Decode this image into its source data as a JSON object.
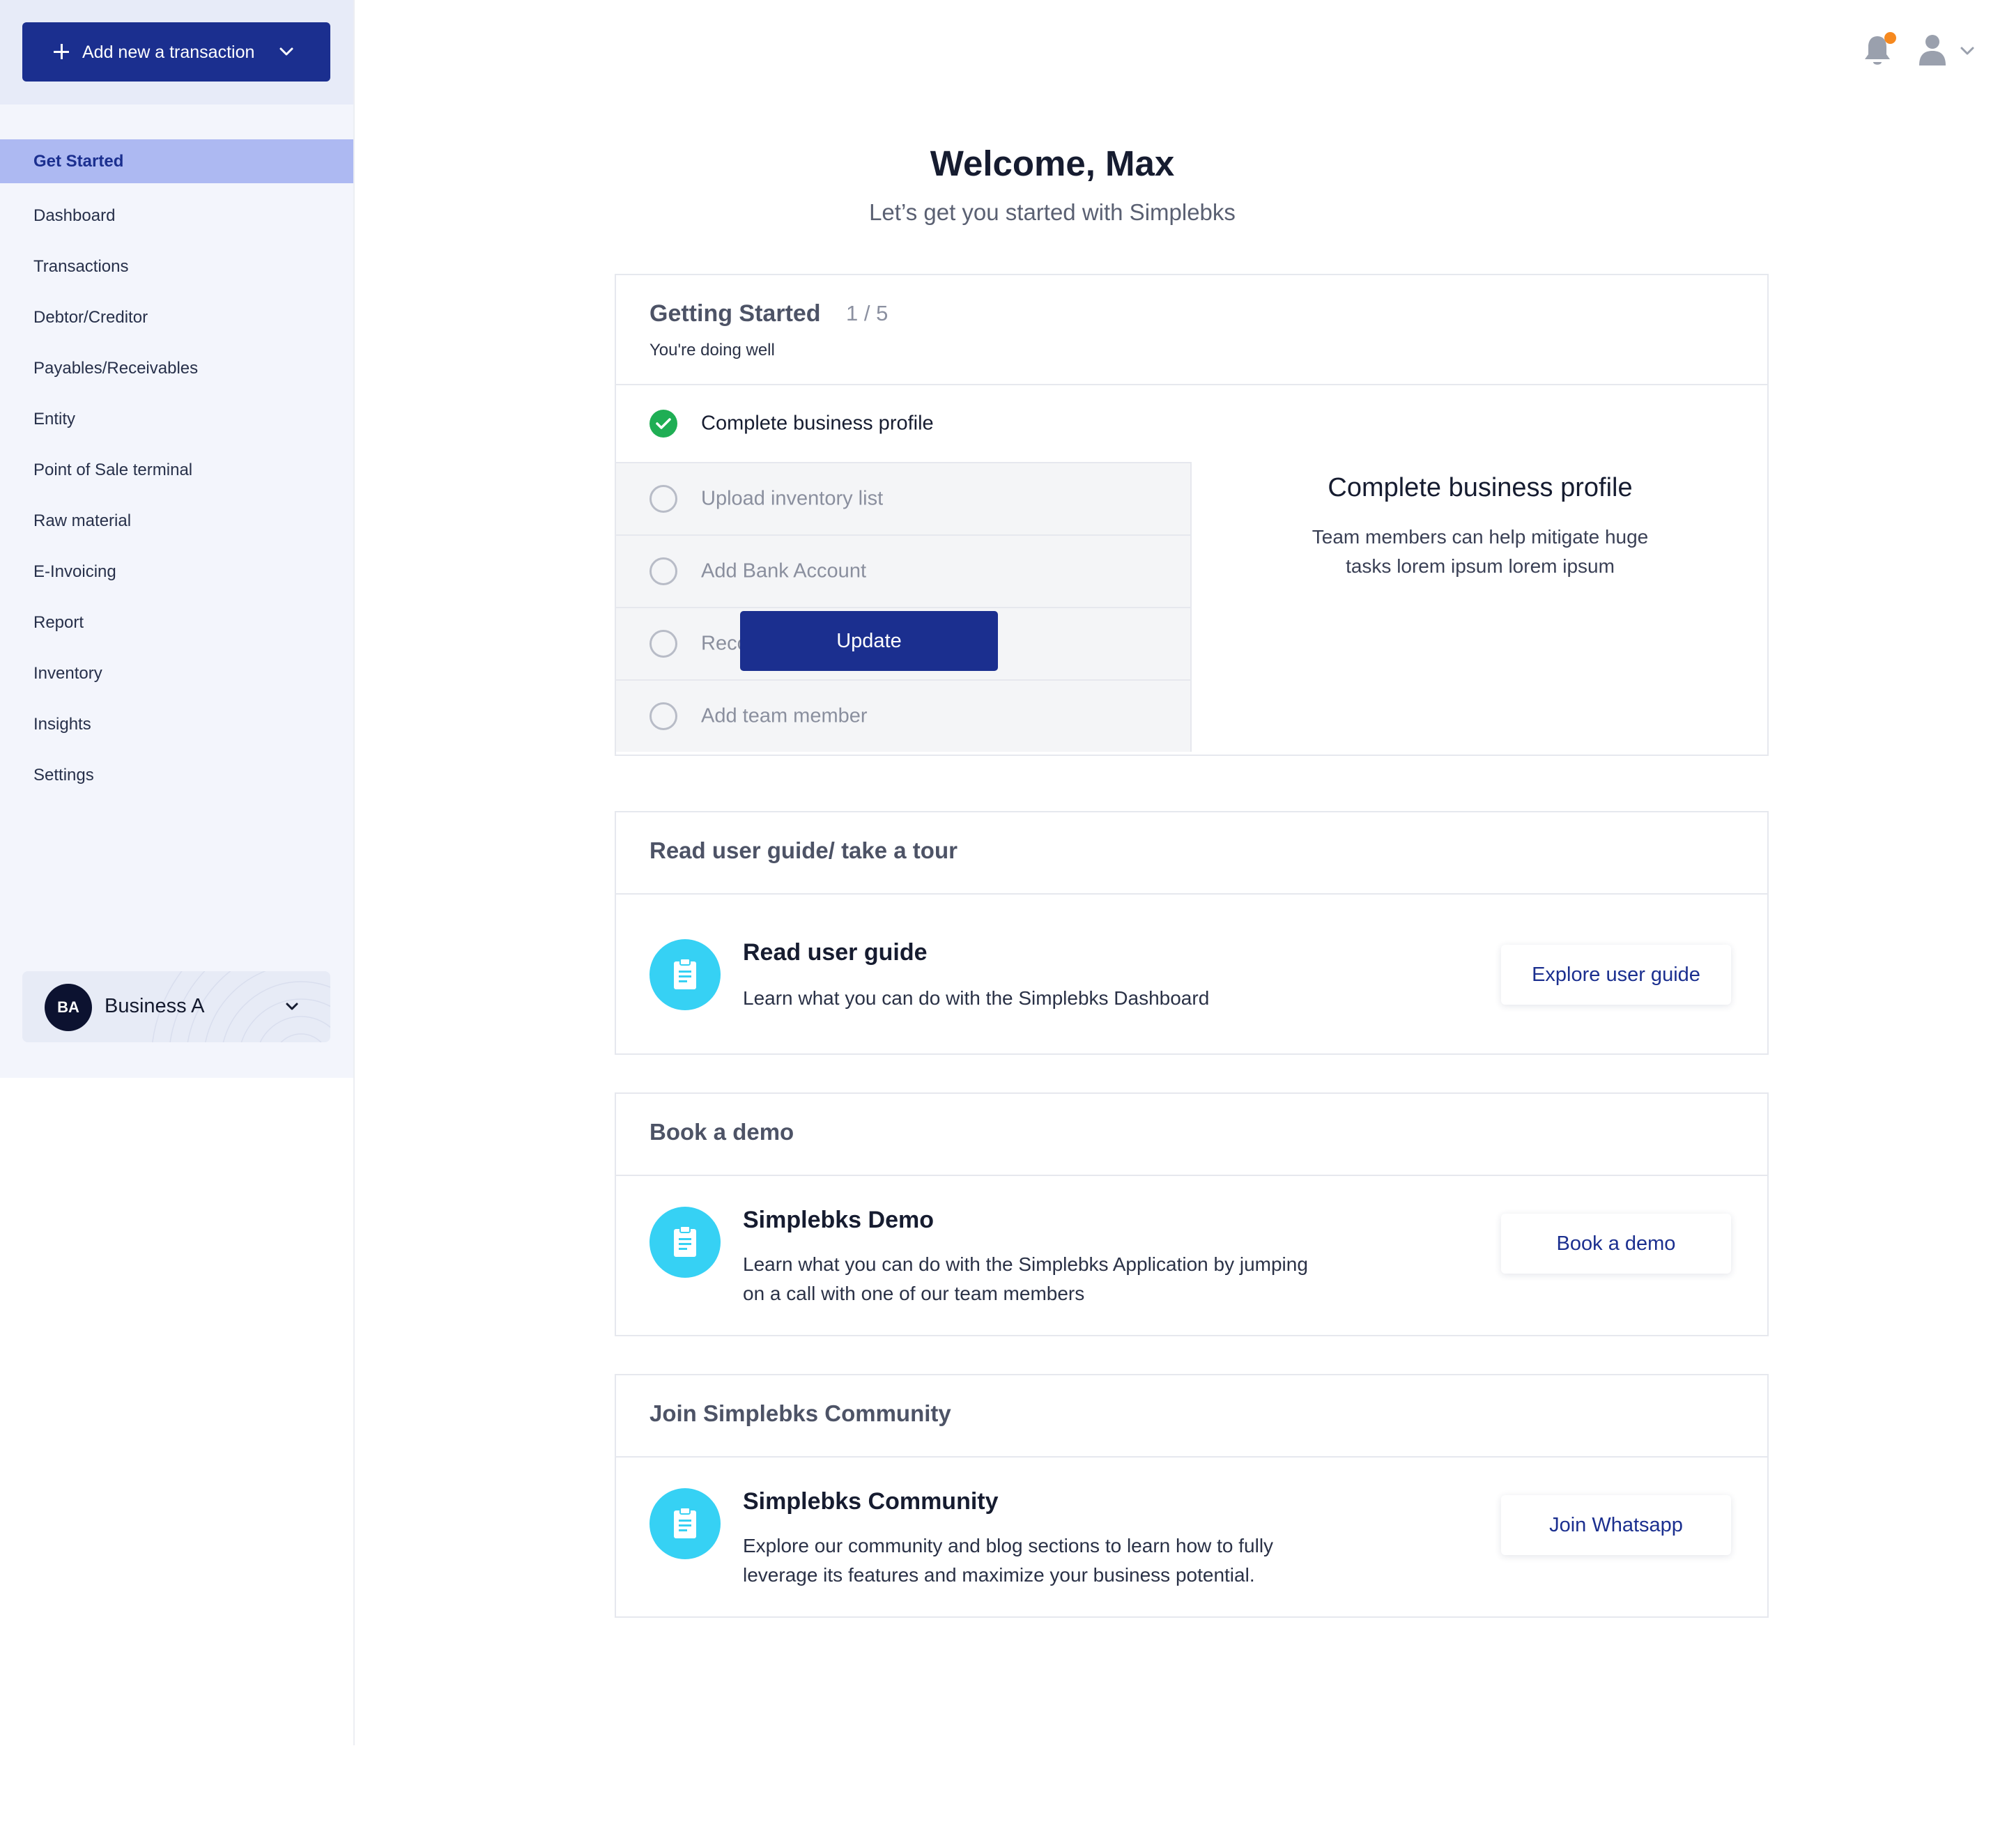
{
  "sidebar": {
    "add_button_label": "Add new a transaction",
    "items": [
      {
        "label": "Get Started",
        "active": true
      },
      {
        "label": "Dashboard"
      },
      {
        "label": "Transactions"
      },
      {
        "label": "Debtor/Creditor"
      },
      {
        "label": "Payables/Receivables"
      },
      {
        "label": "Entity"
      },
      {
        "label": "Point of Sale terminal"
      },
      {
        "label": "Raw material"
      },
      {
        "label": "E-Invoicing"
      },
      {
        "label": "Report"
      },
      {
        "label": "Inventory"
      },
      {
        "label": "Insights"
      },
      {
        "label": "Settings"
      }
    ],
    "business": {
      "initials": "BA",
      "name": "Business A"
    }
  },
  "header": {
    "icons": [
      "bell-icon",
      "user-icon",
      "chevron-down-icon"
    ],
    "notification_color": "#f6891f"
  },
  "main": {
    "welcome": "Welcome, Max",
    "subtitle": "Let’s get you started with Simplebks",
    "getting_started": {
      "title": "Getting Started",
      "progress": "1 / 5",
      "status": "You're doing well",
      "tasks": [
        {
          "label": "Complete business profile",
          "done": true
        },
        {
          "label": "Upload inventory list",
          "done": false
        },
        {
          "label": "Add Bank Account",
          "done": false
        },
        {
          "label": "Record First Sale",
          "done": false
        },
        {
          "label": "Add team member",
          "done": false
        }
      ],
      "detail": {
        "title": "Complete business profile",
        "text": "Team members can help mitigate huge tasks lorem ipsum lorem ipsum",
        "button": "Update"
      }
    },
    "resources": [
      {
        "header": "Read user guide/ take a tour",
        "title": "Read user guide",
        "description": "Learn what you can do with the Simplebks Dashboard",
        "button": "Explore user guide"
      },
      {
        "header": "Book a demo",
        "title": "Simplebks Demo",
        "description": "Learn what you can do with the Simplebks Application by jumping on a call with one of our team members",
        "button": "Book a demo"
      },
      {
        "header": "Join Simplebks Community",
        "title": "Simplebks Community",
        "description": "Explore our community and blog sections to learn how to fully leverage its features and maximize your business potential.",
        "button": "Join Whatsapp"
      }
    ]
  },
  "colors": {
    "primary": "#1b2f8f",
    "active_nav": "#adb9f2",
    "sidebar_bg": "#f3f5fc",
    "success": "#1fae54",
    "resource_icon": "#36d1f4"
  }
}
